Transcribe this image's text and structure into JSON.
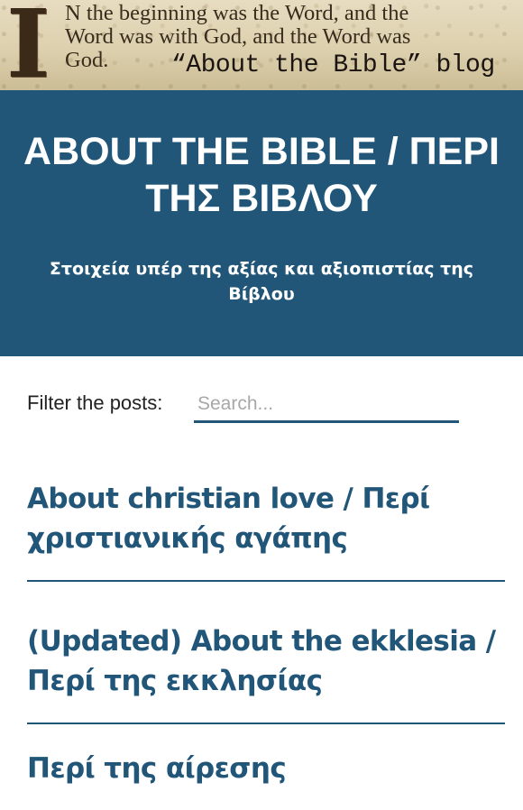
{
  "banner": {
    "drop_cap": "I",
    "verse_lines": [
      "N the beginning was the Word, and the",
      "Word was with God, and the Word was",
      "God."
    ],
    "blog_tag": "“About the Bible” blog"
  },
  "header": {
    "title": "ABOUT THE BIBLE / ΠΕΡΙ ΤΗΣ ΒΙΒΛΟΥ",
    "description": "Στοιχεία υπέρ της αξίας και αξιοπιστίας της Βίβλου"
  },
  "filter": {
    "label": "Filter the posts:",
    "placeholder": "Search...",
    "value": ""
  },
  "posts": [
    {
      "title": "About christian love / Περί χριστιανικής αγάπης"
    },
    {
      "title": "(Updated) About the ekklesia / Περί της εκκλησίας"
    },
    {
      "title": "Περί της αίρεσης"
    }
  ],
  "colors": {
    "brand": "#215679",
    "header_text": "#ffffff",
    "placeholder": "#a8a8a8"
  }
}
